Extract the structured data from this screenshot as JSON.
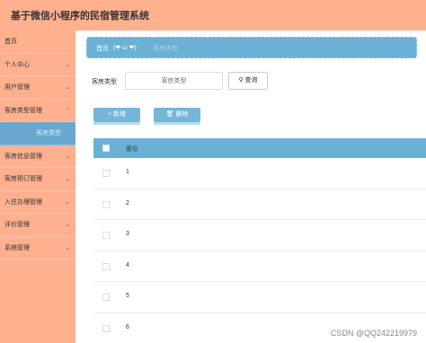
{
  "app": {
    "title": "基于微信小程序的民宿管理系统"
  },
  "sidebar": {
    "items": [
      {
        "label": "首页",
        "chevron": ""
      },
      {
        "label": "个人中心",
        "chevron": "⌄"
      },
      {
        "label": "用户管理",
        "chevron": "⌄"
      },
      {
        "label": "客房类型管理",
        "chevron": "⌃"
      },
      {
        "label": "客房类型",
        "chevron": ""
      },
      {
        "label": "客房信息管理",
        "chevron": "⌄"
      },
      {
        "label": "客房预订管理",
        "chevron": "⌄"
      },
      {
        "label": "入住办理管理",
        "chevron": "⌄"
      },
      {
        "label": "评价管理",
        "chevron": "⌄"
      },
      {
        "label": "系统管理",
        "chevron": "⌄"
      }
    ]
  },
  "breadcrumb": {
    "home": "首页",
    "face": "(❤ ω ❤)",
    "current": "客房类型"
  },
  "search": {
    "label": "客房类型",
    "placeholder": "客房类型",
    "button": "查询",
    "button_icon": "⚲"
  },
  "actions": {
    "add": "+ 新增",
    "delete": "🗑 删除"
  },
  "table": {
    "header": "索引",
    "rows": [
      "1",
      "2",
      "3",
      "4",
      "5",
      "6"
    ]
  },
  "watermark": "CSDN @QQ242219979",
  "colors": {
    "topbar": "#ffb08f",
    "sidebar": "#ffb08f",
    "accent": "#6ab1d6"
  }
}
